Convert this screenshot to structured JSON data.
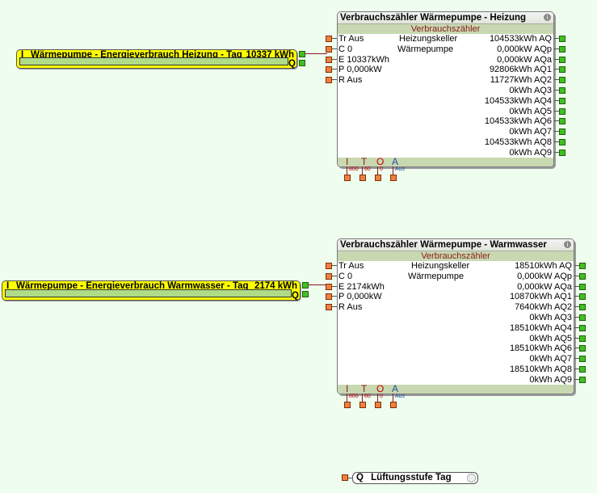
{
  "inputs": [
    {
      "prefix": "I",
      "label": "Wärmepumpe - Energieverbrauch Heizung - Tag",
      "value": "10337 kWh",
      "out_label": "Q"
    },
    {
      "prefix": "I",
      "label": "Wärmepumpe - Energieverbrauch Warmwasser - Tag",
      "value": "2174 kWh",
      "out_label": "Q"
    }
  ],
  "blocks": [
    {
      "title": "Verbrauchszähler Wärmepumpe - Heizung",
      "subtitle": "Verbrauchszähler",
      "info_icon": "i",
      "room": "Heizungskeller",
      "category": "Wärmepumpe",
      "inputs": [
        "Tr Aus",
        "C 0",
        "E 10337kWh",
        "P 0,000kW",
        "R Aus"
      ],
      "outputs": [
        "104533kWh AQ",
        "0,000kW AQp",
        "0,000kW AQa",
        "92806kWh AQ1",
        "11727kWh AQ2",
        "0kWh AQ3",
        "104533kWh AQ4",
        "0kWh AQ5",
        "104533kWh AQ6",
        "0kWh AQ7",
        "104533kWh AQ8",
        "0kWh AQ9"
      ],
      "bottom_labels": [
        "I",
        "T",
        "O",
        "A"
      ],
      "params": [
        "800",
        "60",
        "0",
        "Aus"
      ]
    },
    {
      "title": "Verbrauchszähler Wärmepumpe - Warmwasser",
      "subtitle": "Verbrauchszähler",
      "info_icon": "i",
      "room": "Heizungskeller",
      "category": "Wärmepumpe",
      "inputs": [
        "Tr Aus",
        "C 0",
        "E 2174kWh",
        "P 0,000kW",
        "R Aus"
      ],
      "outputs": [
        "18510kWh AQ",
        "0,000kW AQp",
        "0,000kW AQa",
        "10870kWh AQ1",
        "7640kWh AQ2",
        "0kWh AQ3",
        "18510kWh AQ4",
        "0kWh AQ5",
        "18510kWh AQ6",
        "0kWh AQ7",
        "18510kWh AQ8",
        "0kWh AQ9"
      ],
      "bottom_labels": [
        "I",
        "T",
        "O",
        "A"
      ],
      "params": [
        "800",
        "60",
        "0",
        "Aus"
      ]
    }
  ],
  "output_ref": {
    "prefix": "Q",
    "label": "Lüftungsstufe Tag"
  }
}
